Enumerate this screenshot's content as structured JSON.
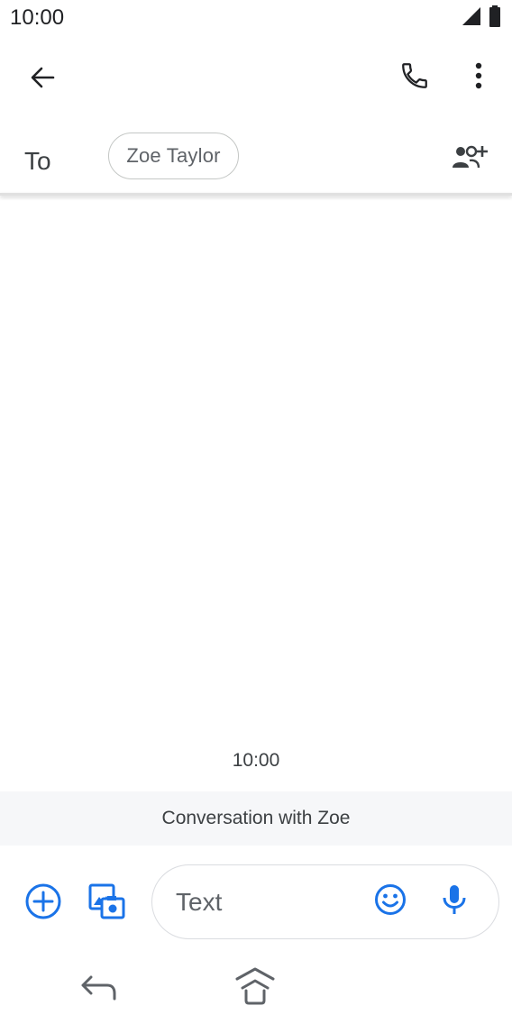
{
  "status_bar": {
    "time": "10:00",
    "icons": [
      "signal-icon",
      "battery-icon"
    ]
  },
  "app_bar": {
    "back_icon": "arrow-back-icon",
    "call_icon": "phone-icon",
    "more_icon": "more-vert-icon"
  },
  "recipients": {
    "to_label": "To",
    "chips": [
      {
        "name": "Zoe Taylor"
      }
    ],
    "add_icon": "group-add-icon"
  },
  "conversation": {
    "timestamp": "10:00",
    "banner": "Conversation with Zoe"
  },
  "compose": {
    "placeholder": "Text",
    "value": "",
    "attach_icon": "add-circle-icon",
    "media_icon": "gallery-camera-icon",
    "emoji_icon": "emoji-icon",
    "mic_icon": "mic-icon"
  },
  "nav_bar": {
    "back_icon": "nav-back-icon",
    "home_icon": "nav-home-icon"
  },
  "colors": {
    "accent": "#1a73e8",
    "text_primary": "#202124",
    "text_secondary": "#5f6368",
    "banner_bg": "#f6f7f9"
  }
}
